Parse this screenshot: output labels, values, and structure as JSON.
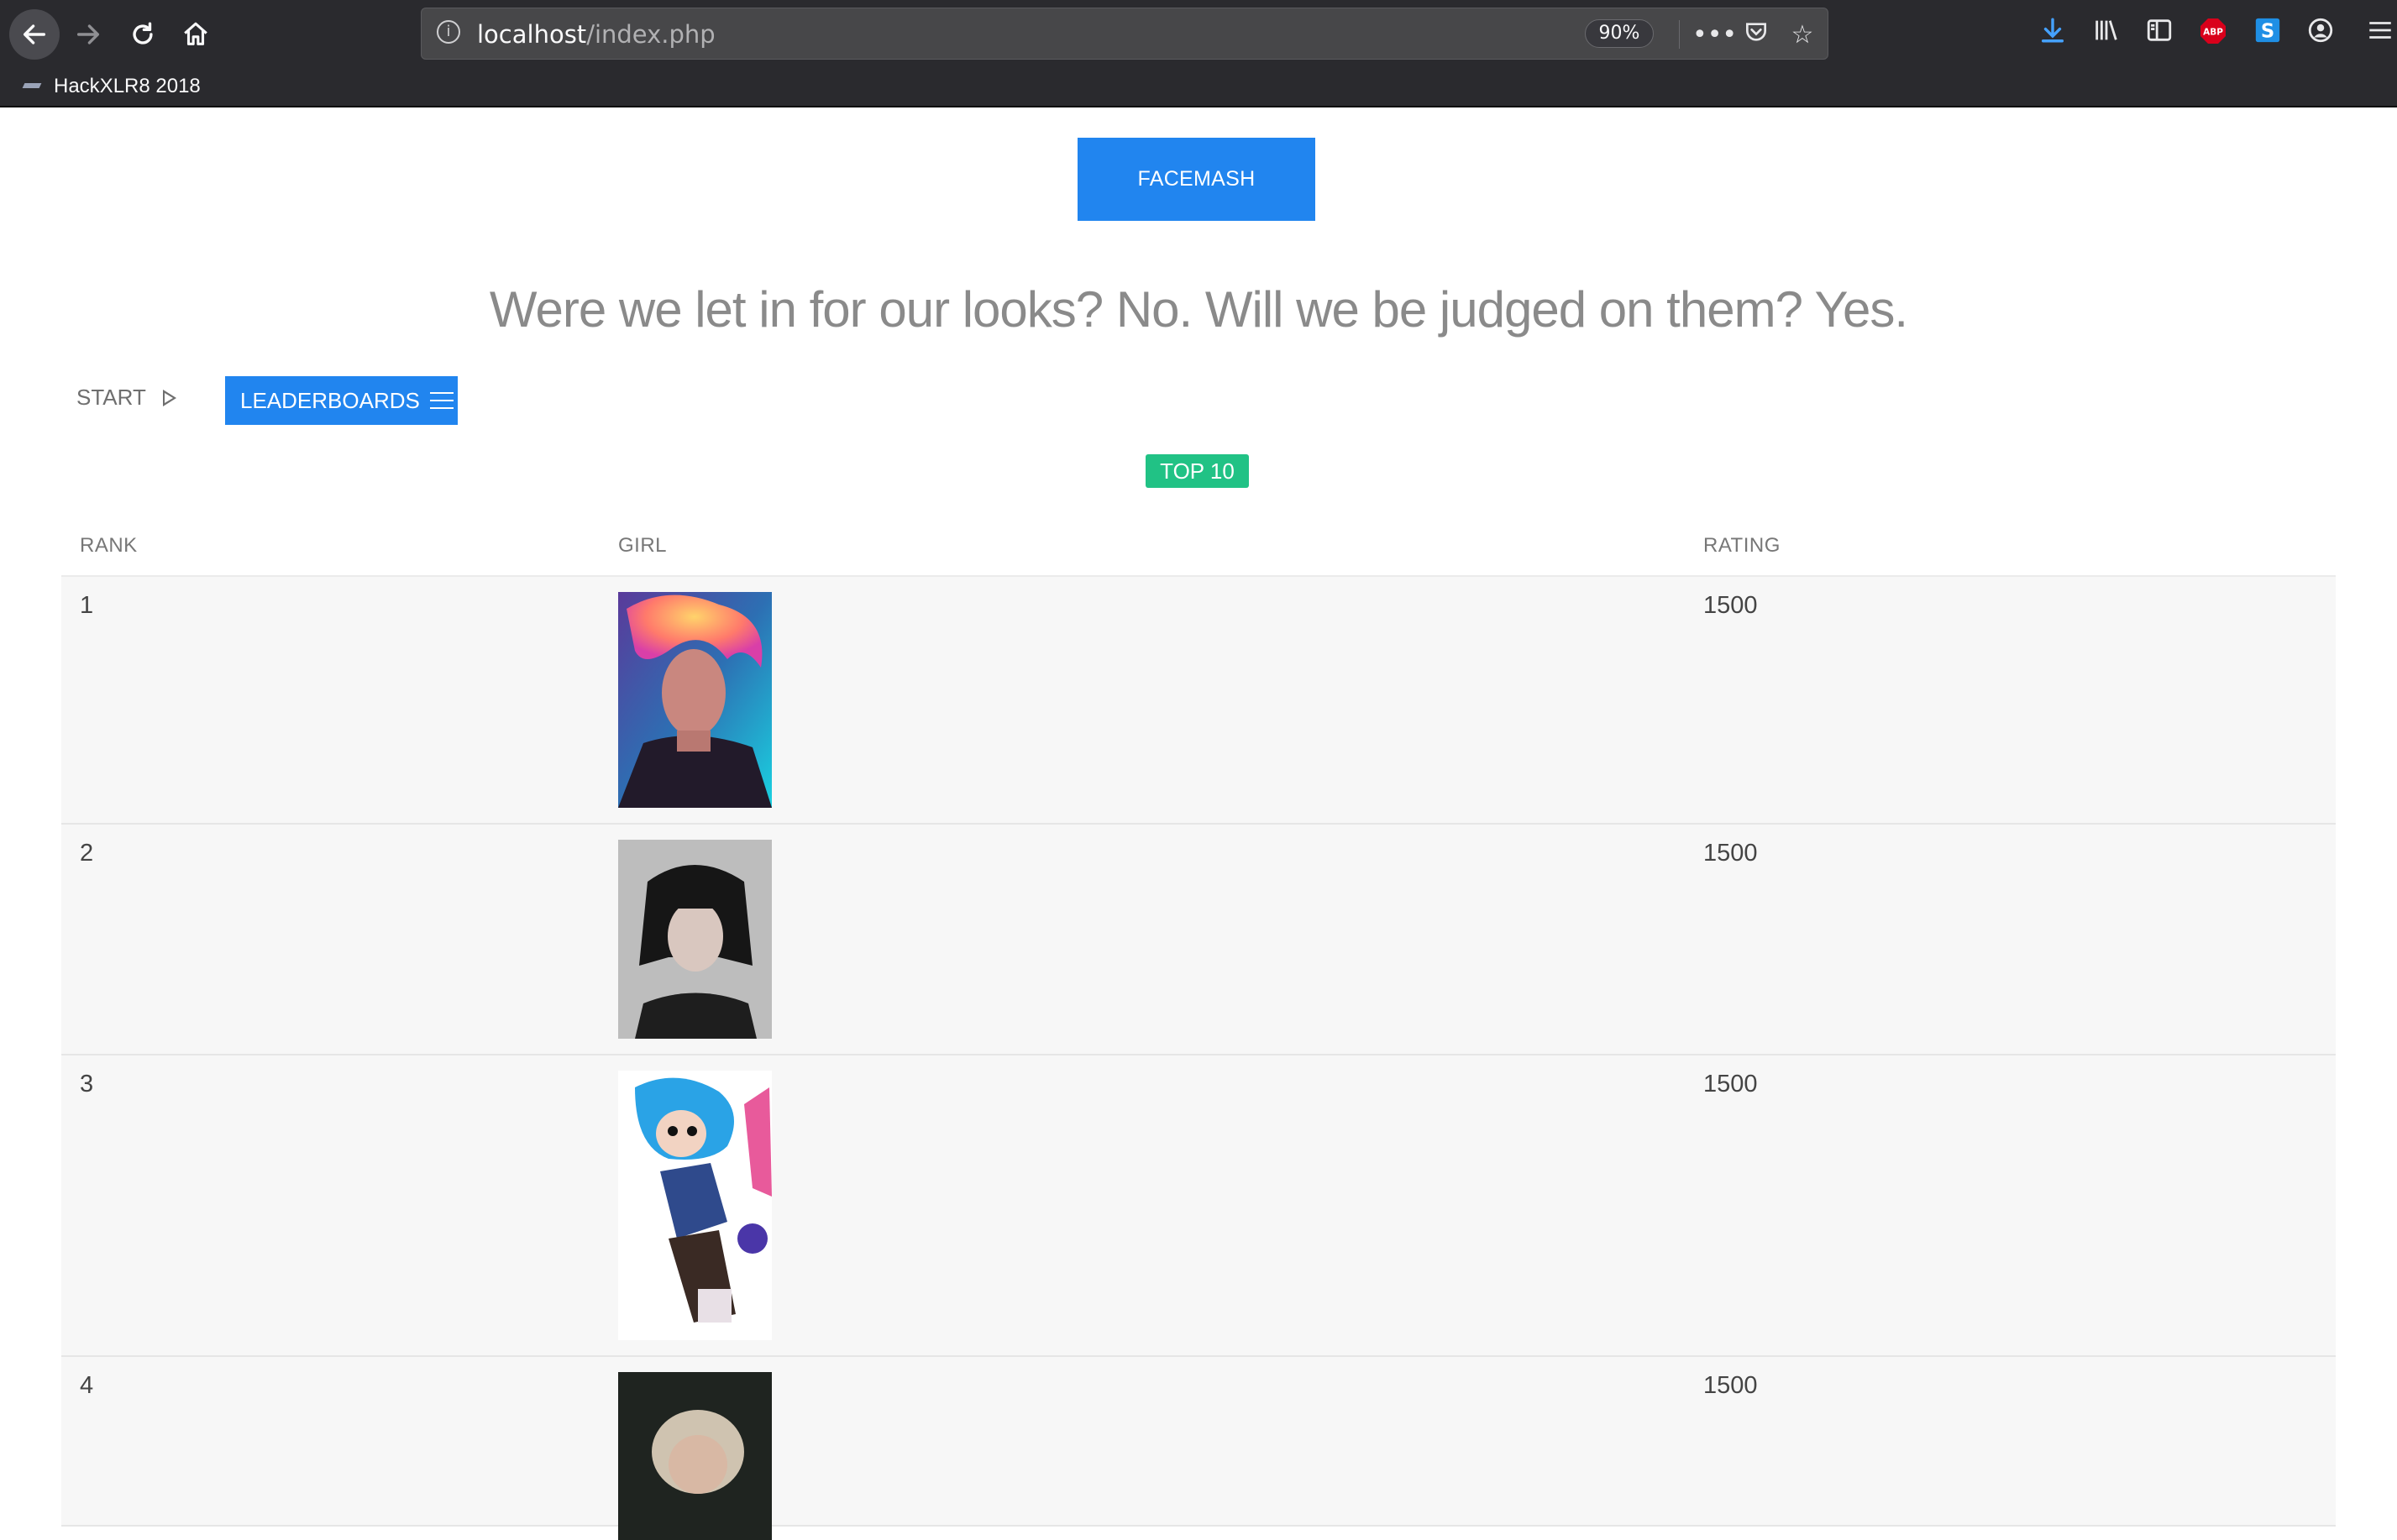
{
  "browser": {
    "url_host": "localhost",
    "url_path": "/index.php",
    "zoom": "90%",
    "bookmark": "HackXLR8 2018",
    "icons": [
      "back-icon",
      "forward-icon",
      "reload-icon",
      "home-icon",
      "info-icon",
      "more-icon",
      "pocket-icon",
      "star-icon",
      "download-icon",
      "library-icon",
      "sidebar-icon",
      "adblock-icon",
      "s-extension-icon",
      "account-icon"
    ]
  },
  "page": {
    "brand_button": "FACEMASH",
    "tagline": "Were we let in for our looks? No. Will we be judged on them? Yes.",
    "start_label": "START",
    "leaderboards_label": "LEADERBOARDS",
    "badge": "TOP 10"
  },
  "table": {
    "headers": [
      "RANK",
      "GIRL",
      "RATING"
    ],
    "rows": [
      {
        "rank": "1",
        "rating": "1500"
      },
      {
        "rank": "2",
        "rating": "1500"
      },
      {
        "rank": "3",
        "rating": "1500"
      },
      {
        "rank": "4",
        "rating": "1500"
      }
    ]
  },
  "colors": {
    "accent": "#2185ef",
    "badge": "#21c285",
    "chrome": "#2a2a2e"
  }
}
